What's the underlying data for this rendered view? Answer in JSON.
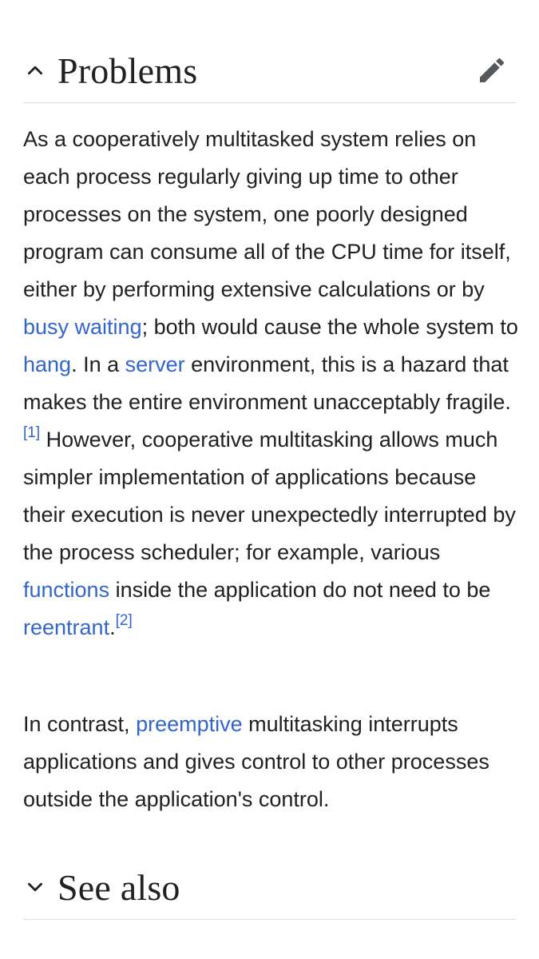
{
  "sections": {
    "problems": {
      "title": "Problems",
      "expanded": true,
      "chevron_icon": "chevron-up-icon",
      "edit_icon": "pencil-icon"
    },
    "see_also": {
      "title": "See also",
      "expanded": false,
      "chevron_icon": "chevron-down-icon"
    }
  },
  "paragraph1": {
    "t1": "As a cooperatively multitasked system relies on each process regularly giving up time to other processes on the system, one poorly designed program can consume all of the CPU time for itself, either by performing extensive calculations or by ",
    "link_busy_waiting": "busy waiting",
    "t2": "; both would cause the whole system to ",
    "link_hang": "hang",
    "t3": ". In a ",
    "link_server": "server",
    "t4": " environment, this is a hazard that makes the entire environment unacceptably fragile.",
    "ref1": "[1]",
    "t5": " However, cooperative multitasking allows much simpler implementation of applications because their execution is never unexpectedly interrupted by the process scheduler; for example, various ",
    "link_functions": "functions",
    "t6": " inside the application do not need to be ",
    "link_reentrant": "reentrant",
    "t7": ".",
    "ref2": "[2]"
  },
  "paragraph2": {
    "t1": "In contrast, ",
    "link_preemptive": "preemptive",
    "t2": " multitasking interrupts applications and gives control to other processes outside the application's control."
  },
  "colors": {
    "text": "#202122",
    "link": "#3366cc",
    "icon": "#54595d",
    "divider": "#dcdde0"
  }
}
